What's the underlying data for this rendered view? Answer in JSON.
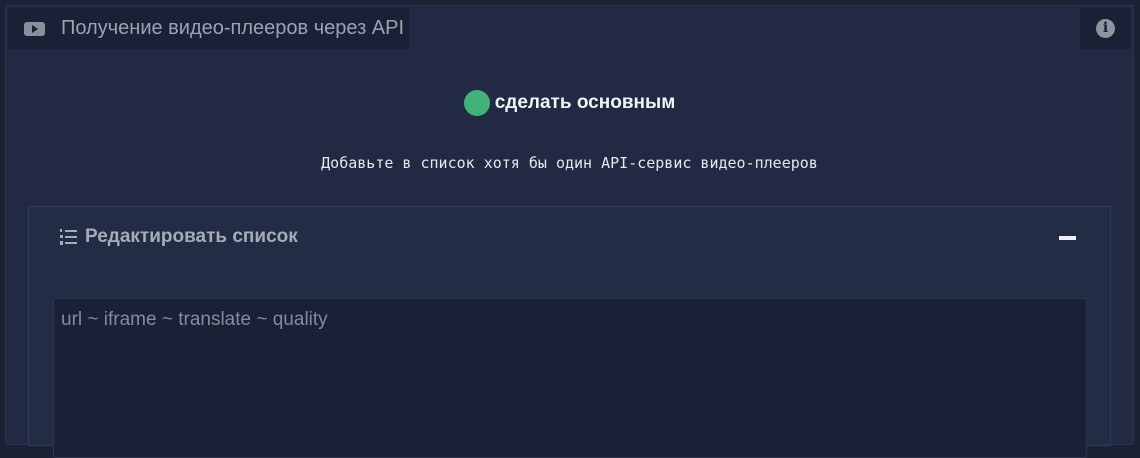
{
  "header": {
    "title": "Получение видео-плееров через API",
    "icon": "youtube-play-icon",
    "info_icon": "info-icon",
    "info_glyph": "i"
  },
  "toggle": {
    "label": "сделать основным",
    "state_color": "#3fb37a"
  },
  "hint": "Добавьте в список хотя бы один API-сервис видео-плееров",
  "editor": {
    "title": "Редактировать список",
    "list_icon": "numbered-list-icon",
    "collapse_icon": "minus-icon",
    "textarea": {
      "value": "",
      "placeholder": "url ~ iframe ~ translate ~ quality"
    }
  }
}
